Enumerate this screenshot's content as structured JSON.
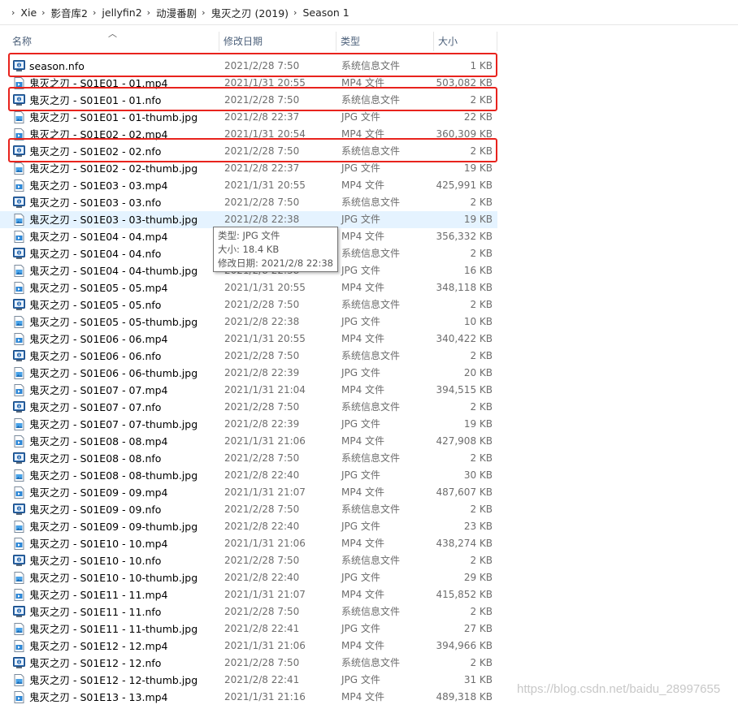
{
  "breadcrumb": [
    "Xie",
    "影音库2",
    "jellyfin2",
    "动漫番剧",
    "鬼灭之刃 (2019)",
    "Season 1"
  ],
  "columns": {
    "name": "名称",
    "date": "修改日期",
    "type": "类型",
    "size": "大小"
  },
  "files": [
    {
      "name": "season.nfo",
      "date": "2021/2/28 7:50",
      "type": "系统信息文件",
      "size": "1 KB",
      "kind": "nfo",
      "highlighted": true
    },
    {
      "name": "鬼灭之刃 - S01E01 - 01.mp4",
      "date": "2021/1/31 20:55",
      "type": "MP4 文件",
      "size": "503,082 KB",
      "kind": "mp4"
    },
    {
      "name": "鬼灭之刃 - S01E01 - 01.nfo",
      "date": "2021/2/28 7:50",
      "type": "系统信息文件",
      "size": "2 KB",
      "kind": "nfo",
      "highlighted": true
    },
    {
      "name": "鬼灭之刃 - S01E01 - 01-thumb.jpg",
      "date": "2021/2/8 22:37",
      "type": "JPG 文件",
      "size": "22 KB",
      "kind": "jpg"
    },
    {
      "name": "鬼灭之刃 - S01E02 - 02.mp4",
      "date": "2021/1/31 20:54",
      "type": "MP4 文件",
      "size": "360,309 KB",
      "kind": "mp4"
    },
    {
      "name": "鬼灭之刃 - S01E02 - 02.nfo",
      "date": "2021/2/28 7:50",
      "type": "系统信息文件",
      "size": "2 KB",
      "kind": "nfo",
      "highlighted": true
    },
    {
      "name": "鬼灭之刃 - S01E02 - 02-thumb.jpg",
      "date": "2021/2/8 22:37",
      "type": "JPG 文件",
      "size": "19 KB",
      "kind": "jpg"
    },
    {
      "name": "鬼灭之刃 - S01E03 - 03.mp4",
      "date": "2021/1/31 20:55",
      "type": "MP4 文件",
      "size": "425,991 KB",
      "kind": "mp4"
    },
    {
      "name": "鬼灭之刃 - S01E03 - 03.nfo",
      "date": "2021/2/28 7:50",
      "type": "系统信息文件",
      "size": "2 KB",
      "kind": "nfo"
    },
    {
      "name": "鬼灭之刃 - S01E03 - 03-thumb.jpg",
      "date": "2021/2/8 22:38",
      "type": "JPG 文件",
      "size": "19 KB",
      "kind": "jpg",
      "hover": true
    },
    {
      "name": "鬼灭之刃 - S01E04 - 04.mp4",
      "date": "2021/1/31 20:55",
      "type": "MP4 文件",
      "size": "356,332 KB",
      "kind": "mp4"
    },
    {
      "name": "鬼灭之刃 - S01E04 - 04.nfo",
      "date": "2021/2/28 7:50",
      "type": "系统信息文件",
      "size": "2 KB",
      "kind": "nfo"
    },
    {
      "name": "鬼灭之刃 - S01E04 - 04-thumb.jpg",
      "date": "2021/2/8 22:38",
      "type": "JPG 文件",
      "size": "16 KB",
      "kind": "jpg"
    },
    {
      "name": "鬼灭之刃 - S01E05 - 05.mp4",
      "date": "2021/1/31 20:55",
      "type": "MP4 文件",
      "size": "348,118 KB",
      "kind": "mp4"
    },
    {
      "name": "鬼灭之刃 - S01E05 - 05.nfo",
      "date": "2021/2/28 7:50",
      "type": "系统信息文件",
      "size": "2 KB",
      "kind": "nfo"
    },
    {
      "name": "鬼灭之刃 - S01E05 - 05-thumb.jpg",
      "date": "2021/2/8 22:38",
      "type": "JPG 文件",
      "size": "10 KB",
      "kind": "jpg"
    },
    {
      "name": "鬼灭之刃 - S01E06 - 06.mp4",
      "date": "2021/1/31 20:55",
      "type": "MP4 文件",
      "size": "340,422 KB",
      "kind": "mp4"
    },
    {
      "name": "鬼灭之刃 - S01E06 - 06.nfo",
      "date": "2021/2/28 7:50",
      "type": "系统信息文件",
      "size": "2 KB",
      "kind": "nfo"
    },
    {
      "name": "鬼灭之刃 - S01E06 - 06-thumb.jpg",
      "date": "2021/2/8 22:39",
      "type": "JPG 文件",
      "size": "20 KB",
      "kind": "jpg"
    },
    {
      "name": "鬼灭之刃 - S01E07 - 07.mp4",
      "date": "2021/1/31 21:04",
      "type": "MP4 文件",
      "size": "394,515 KB",
      "kind": "mp4"
    },
    {
      "name": "鬼灭之刃 - S01E07 - 07.nfo",
      "date": "2021/2/28 7:50",
      "type": "系统信息文件",
      "size": "2 KB",
      "kind": "nfo"
    },
    {
      "name": "鬼灭之刃 - S01E07 - 07-thumb.jpg",
      "date": "2021/2/8 22:39",
      "type": "JPG 文件",
      "size": "19 KB",
      "kind": "jpg"
    },
    {
      "name": "鬼灭之刃 - S01E08 - 08.mp4",
      "date": "2021/1/31 21:06",
      "type": "MP4 文件",
      "size": "427,908 KB",
      "kind": "mp4"
    },
    {
      "name": "鬼灭之刃 - S01E08 - 08.nfo",
      "date": "2021/2/28 7:50",
      "type": "系统信息文件",
      "size": "2 KB",
      "kind": "nfo"
    },
    {
      "name": "鬼灭之刃 - S01E08 - 08-thumb.jpg",
      "date": "2021/2/8 22:40",
      "type": "JPG 文件",
      "size": "30 KB",
      "kind": "jpg"
    },
    {
      "name": "鬼灭之刃 - S01E09 - 09.mp4",
      "date": "2021/1/31 21:07",
      "type": "MP4 文件",
      "size": "487,607 KB",
      "kind": "mp4"
    },
    {
      "name": "鬼灭之刃 - S01E09 - 09.nfo",
      "date": "2021/2/28 7:50",
      "type": "系统信息文件",
      "size": "2 KB",
      "kind": "nfo"
    },
    {
      "name": "鬼灭之刃 - S01E09 - 09-thumb.jpg",
      "date": "2021/2/8 22:40",
      "type": "JPG 文件",
      "size": "23 KB",
      "kind": "jpg"
    },
    {
      "name": "鬼灭之刃 - S01E10 - 10.mp4",
      "date": "2021/1/31 21:06",
      "type": "MP4 文件",
      "size": "438,274 KB",
      "kind": "mp4"
    },
    {
      "name": "鬼灭之刃 - S01E10 - 10.nfo",
      "date": "2021/2/28 7:50",
      "type": "系统信息文件",
      "size": "2 KB",
      "kind": "nfo"
    },
    {
      "name": "鬼灭之刃 - S01E10 - 10-thumb.jpg",
      "date": "2021/2/8 22:40",
      "type": "JPG 文件",
      "size": "29 KB",
      "kind": "jpg"
    },
    {
      "name": "鬼灭之刃 - S01E11 - 11.mp4",
      "date": "2021/1/31 21:07",
      "type": "MP4 文件",
      "size": "415,852 KB",
      "kind": "mp4"
    },
    {
      "name": "鬼灭之刃 - S01E11 - 11.nfo",
      "date": "2021/2/28 7:50",
      "type": "系统信息文件",
      "size": "2 KB",
      "kind": "nfo"
    },
    {
      "name": "鬼灭之刃 - S01E11 - 11-thumb.jpg",
      "date": "2021/2/8 22:41",
      "type": "JPG 文件",
      "size": "27 KB",
      "kind": "jpg"
    },
    {
      "name": "鬼灭之刃 - S01E12 - 12.mp4",
      "date": "2021/1/31 21:06",
      "type": "MP4 文件",
      "size": "394,966 KB",
      "kind": "mp4"
    },
    {
      "name": "鬼灭之刃 - S01E12 - 12.nfo",
      "date": "2021/2/28 7:50",
      "type": "系统信息文件",
      "size": "2 KB",
      "kind": "nfo"
    },
    {
      "name": "鬼灭之刃 - S01E12 - 12-thumb.jpg",
      "date": "2021/2/8 22:41",
      "type": "JPG 文件",
      "size": "31 KB",
      "kind": "jpg"
    },
    {
      "name": "鬼灭之刃 - S01E13 - 13.mp4",
      "date": "2021/1/31 21:16",
      "type": "MP4 文件",
      "size": "489,318 KB",
      "kind": "mp4"
    }
  ],
  "tooltip": {
    "type_line": "类型: JPG 文件",
    "size_line": "大小: 18.4 KB",
    "date_line": "修改日期: 2021/2/8 22:38"
  },
  "watermark": "https://blog.csdn.net/baidu_28997655",
  "icons": {
    "breadcrumb_separator": "chevron-right-icon",
    "sort": "sort-ascending-icon",
    "nfo": "system-info-file-icon",
    "mp4": "video-file-icon",
    "jpg": "image-file-icon"
  },
  "colors": {
    "highlight_border": "#e8231d",
    "hover_row": "#e5f3ff",
    "header_text": "#4c607a",
    "secondary_text": "#6d6d6d"
  }
}
